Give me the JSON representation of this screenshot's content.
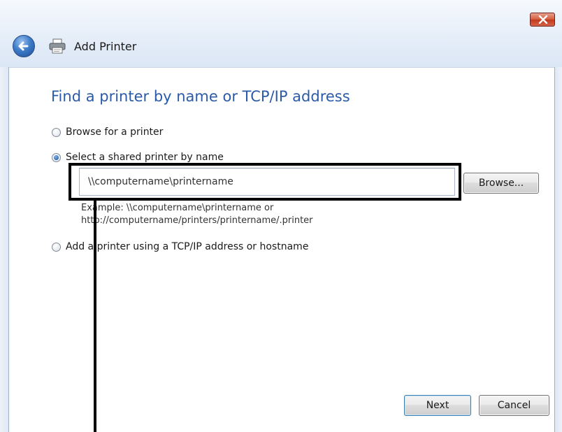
{
  "window": {
    "title": "Add Printer"
  },
  "page": {
    "heading": "Find a printer by name or TCP/IP address"
  },
  "options": {
    "browse": {
      "label": "Browse for a printer",
      "selected": false
    },
    "shared": {
      "label": "Select a shared printer by name",
      "selected": true
    },
    "tcpip": {
      "label": "Add a printer using a TCP/IP address or hostname",
      "selected": false
    }
  },
  "shared_printer": {
    "value": "\\\\computername\\printername",
    "browse_label": "Browse...",
    "example_line1": "Example: \\\\computername\\printername or",
    "example_line2": "http://computername/printers/printername/.printer"
  },
  "footer": {
    "next_label": "Next",
    "cancel_label": "Cancel"
  },
  "colors": {
    "heading": "#2a5aa8",
    "close_button": "#c2391b",
    "callout": "#000000"
  }
}
